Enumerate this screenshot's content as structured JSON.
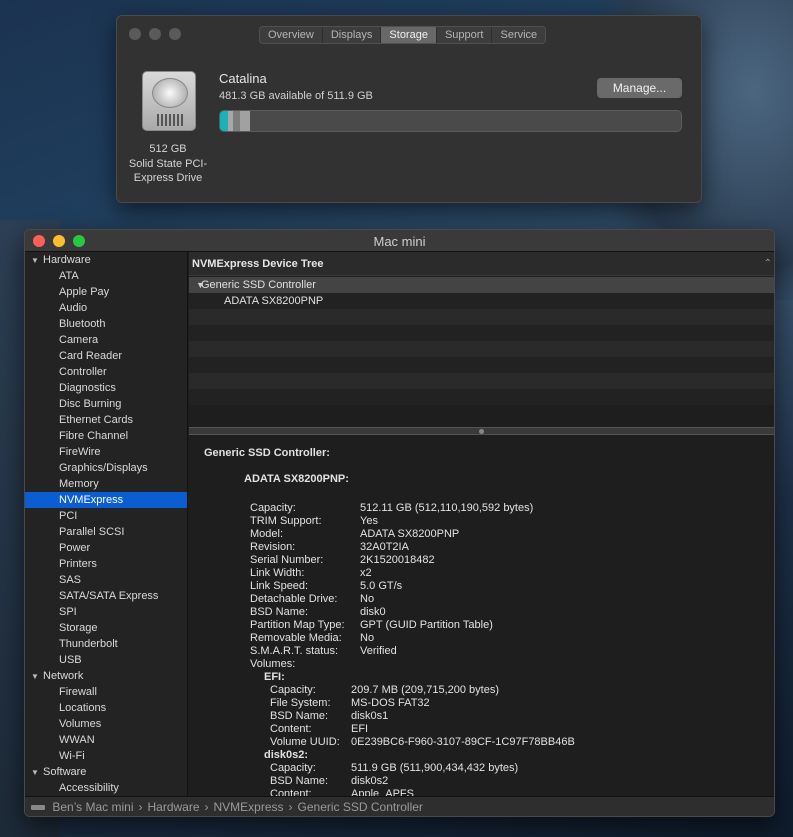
{
  "about_window": {
    "tabs": [
      {
        "label": "Overview",
        "active": false
      },
      {
        "label": "Displays",
        "active": false
      },
      {
        "label": "Storage",
        "active": true
      },
      {
        "label": "Support",
        "active": false
      },
      {
        "label": "Service",
        "active": false
      }
    ],
    "drive_caption": [
      "512 GB",
      "Solid State PCI-",
      "Express Drive"
    ],
    "volume_name": "Catalina",
    "available_text": "481.3 GB available of 511.9 GB",
    "manage_label": "Manage...",
    "storage_segments": [
      {
        "fraction": 0.018,
        "color": "#17b3b8"
      },
      {
        "fraction": 0.01,
        "color": "#a8a8a8"
      },
      {
        "fraction": 0.016,
        "color": "#7c7c7c"
      },
      {
        "fraction": 0.02,
        "color": "#a1a1a1"
      }
    ]
  },
  "sysinfo_window": {
    "title": "Mac mini",
    "sidebar": {
      "groups": [
        {
          "label": "Hardware",
          "items": [
            "ATA",
            "Apple Pay",
            "Audio",
            "Bluetooth",
            "Camera",
            "Card Reader",
            "Controller",
            "Diagnostics",
            "Disc Burning",
            "Ethernet Cards",
            "Fibre Channel",
            "FireWire",
            "Graphics/Displays",
            "Memory",
            "NVMExpress",
            "PCI",
            "Parallel SCSI",
            "Power",
            "Printers",
            "SAS",
            "SATA/SATA Express",
            "SPI",
            "Storage",
            "Thunderbolt",
            "USB"
          ]
        },
        {
          "label": "Network",
          "items": [
            "Firewall",
            "Locations",
            "Volumes",
            "WWAN",
            "Wi-Fi"
          ]
        },
        {
          "label": "Software",
          "items": [
            "Accessibility"
          ]
        }
      ],
      "selected": "NVMExpress"
    },
    "tree": {
      "header": "NVMExpress Device Tree",
      "controller": "Generic SSD Controller",
      "device": "ADATA SX8200PNP",
      "empty_rows": 6
    },
    "detail": {
      "heading": "Generic SSD Controller:",
      "device_heading": "ADATA SX8200PNP:",
      "properties": [
        {
          "key": "Capacity:",
          "value": "512.11 GB (512,110,190,592 bytes)"
        },
        {
          "key": "TRIM Support:",
          "value": "Yes"
        },
        {
          "key": "Model:",
          "value": "ADATA SX8200PNP"
        },
        {
          "key": "Revision:",
          "value": "32A0T2IA"
        },
        {
          "key": "Serial Number:",
          "value": "2K1520018482"
        },
        {
          "key": "Link Width:",
          "value": "x2"
        },
        {
          "key": "Link Speed:",
          "value": "5.0 GT/s"
        },
        {
          "key": "Detachable Drive:",
          "value": "No"
        },
        {
          "key": "BSD Name:",
          "value": "disk0"
        },
        {
          "key": "Partition Map Type:",
          "value": "GPT (GUID Partition Table)"
        },
        {
          "key": "Removable Media:",
          "value": "No"
        },
        {
          "key": "S.M.A.R.T. status:",
          "value": "Verified"
        },
        {
          "key": "Volumes:",
          "value": ""
        }
      ],
      "volumes": [
        {
          "name": "EFI:",
          "props": [
            {
              "key": "Capacity:",
              "value": "209.7 MB (209,715,200 bytes)"
            },
            {
              "key": "File System:",
              "value": "MS-DOS FAT32"
            },
            {
              "key": "BSD Name:",
              "value": "disk0s1"
            },
            {
              "key": "Content:",
              "value": "EFI"
            },
            {
              "key": "Volume UUID:",
              "value": "0E239BC6-F960-3107-89CF-1C97F78BB46B"
            }
          ]
        },
        {
          "name": "disk0s2:",
          "props": [
            {
              "key": "Capacity:",
              "value": "511.9 GB (511,900,434,432 bytes)"
            },
            {
              "key": "BSD Name:",
              "value": "disk0s2"
            },
            {
              "key": "Content:",
              "value": "Apple_APFS"
            }
          ]
        }
      ]
    },
    "breadcrumb": [
      "Ben’s Mac mini",
      "Hardware",
      "NVMExpress",
      "Generic SSD Controller"
    ],
    "breadcrumb_sep": "›"
  }
}
